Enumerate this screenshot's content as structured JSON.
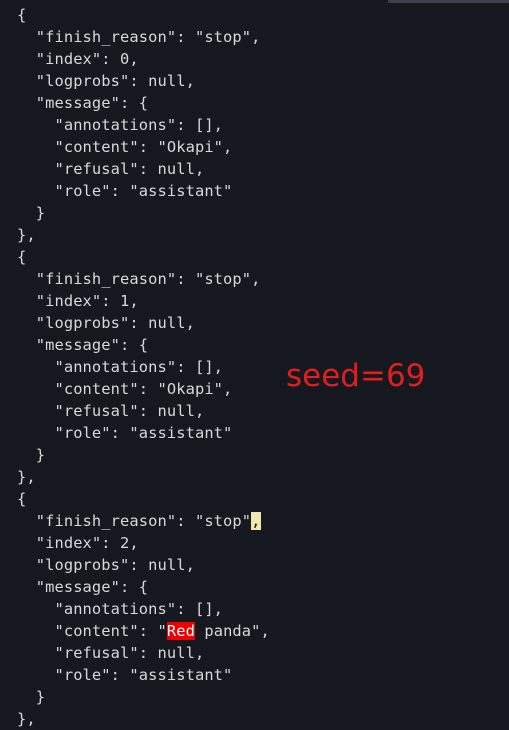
{
  "theme": {
    "background": "#15181e",
    "text": "#d8d8d8",
    "highlight": "#ee0000",
    "cursor": "#f0e6b0",
    "label_color": "#e01e1e"
  },
  "lines": [
    "{",
    "  \"finish_reason\": \"stop\",",
    "  \"index\": 0,",
    "  \"logprobs\": null,",
    "  \"message\": {",
    "    \"annotations\": [],",
    "    \"content\": \"Okapi\",",
    "    \"refusal\": null,",
    "    \"role\": \"assistant\"",
    "  }",
    "},",
    "{",
    "  \"finish_reason\": \"stop\",",
    "  \"index\": 1,",
    "  \"logprobs\": null,",
    "  \"message\": {",
    "    \"annotations\": [],",
    "    \"content\": \"Okapi\",",
    "    \"refusal\": null,",
    "    \"role\": \"assistant\"",
    "  }",
    "},",
    "{",
    "  \"finish_reason\": \"stop\",",
    "  \"index\": 2,",
    "  \"logprobs\": null,",
    "  \"message\": {",
    "    \"annotations\": [],",
    "    \"content\": \"Red panda\",",
    "    \"refusal\": null,",
    "    \"role\": \"assistant\"",
    "  }",
    "},"
  ],
  "highlights": {
    "cursor_line": 23,
    "cursor_text": ",",
    "search_line": 28,
    "search_text": "Red"
  },
  "overlay": {
    "label": "seed=69"
  }
}
